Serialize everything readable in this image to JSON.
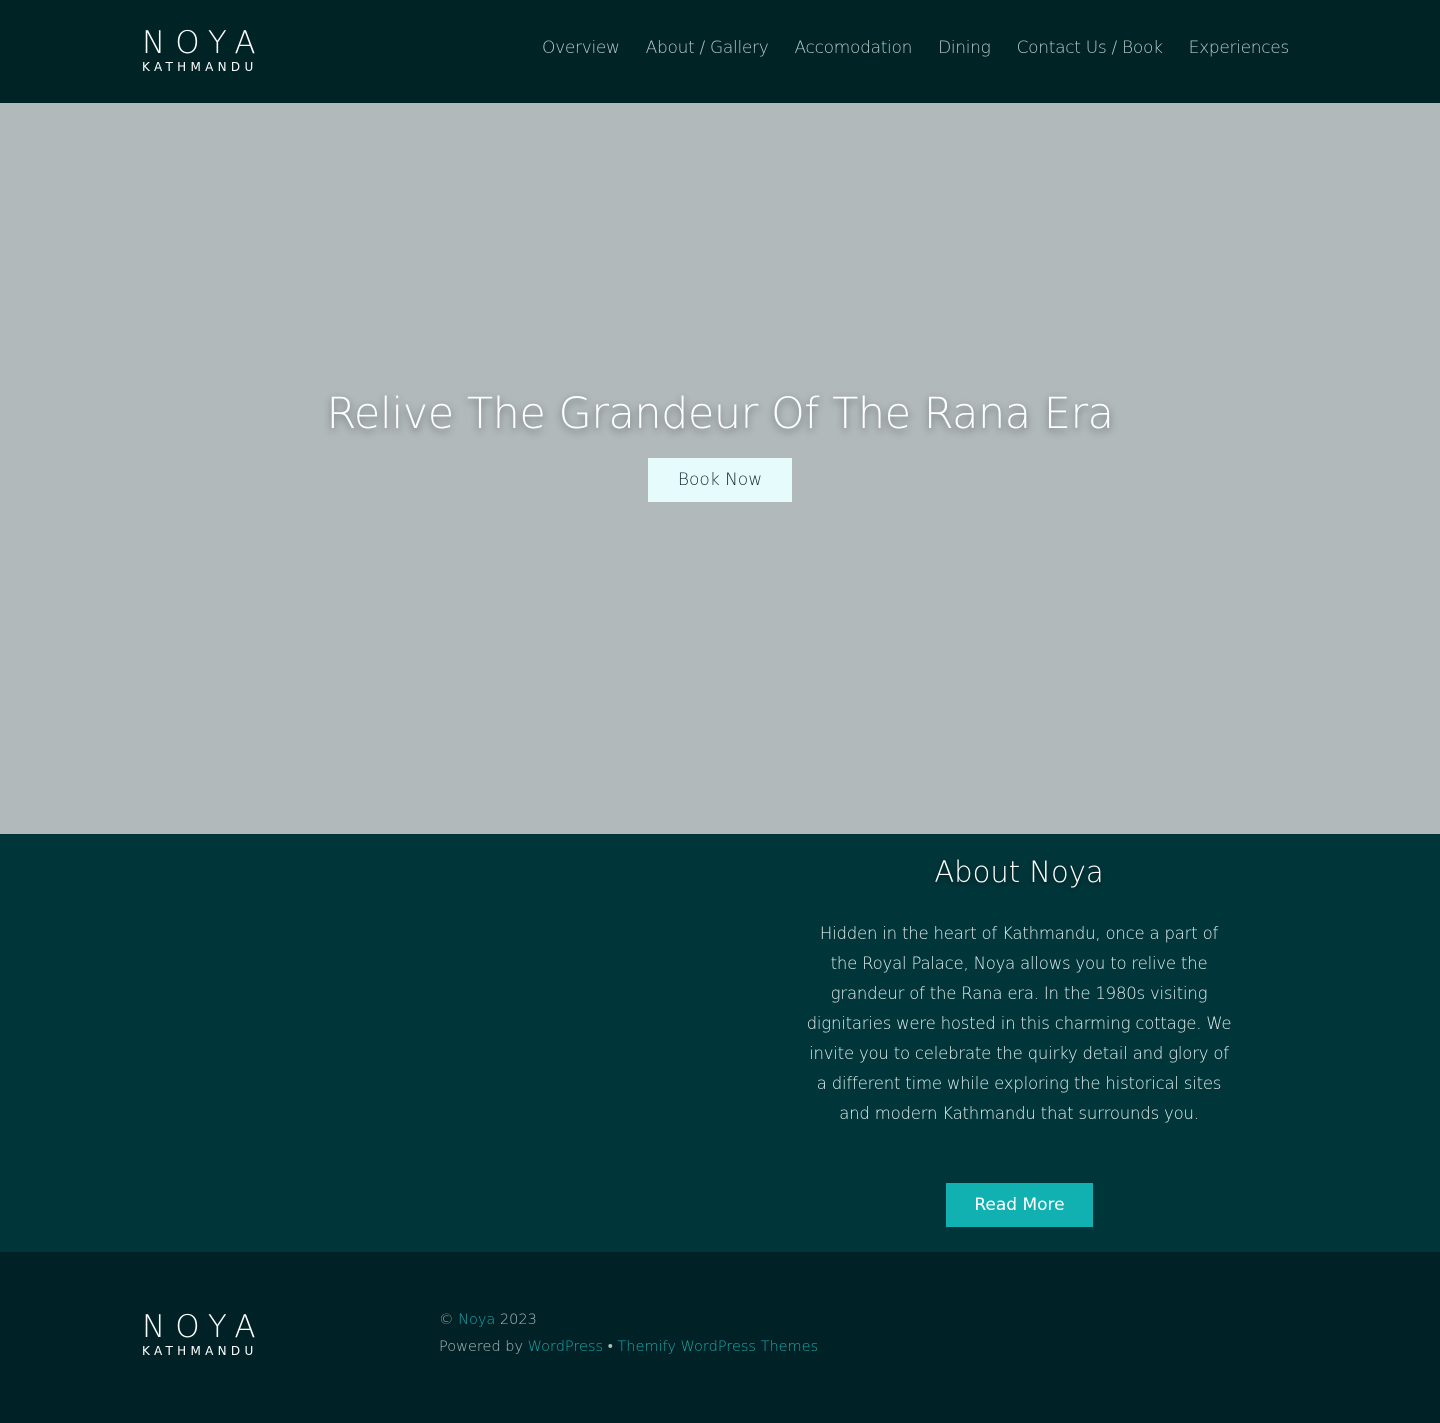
{
  "brand": {
    "name": "NOYA",
    "subtitle": "KATHMANDU"
  },
  "nav": {
    "items": [
      {
        "label": "Overview"
      },
      {
        "label": "About / Gallery"
      },
      {
        "label": "Accomodation"
      },
      {
        "label": "Dining"
      },
      {
        "label": "Contact Us / Book"
      },
      {
        "label": "Experiences"
      }
    ]
  },
  "hero": {
    "title": "Relive The Grandeur Of The Rana Era",
    "button_label": "Book Now"
  },
  "about": {
    "title": "About Noya",
    "text": "Hidden in the heart of Kathmandu, once a part of the Royal Palace, Noya allows you to relive the grandeur of the Rana era. In the 1980s visiting dignitaries were hosted in this charming cottage. We invite you to celebrate the quirky detail and glory of a different time while exploring the historical sites and modern Kathmandu that surrounds you.",
    "button_label": "Read More"
  },
  "footer": {
    "copyright_symbol": "©",
    "site_link": "Noya",
    "year": "2023",
    "powered_by": "Powered by",
    "wordpress_link": "WordPress",
    "separator": "•",
    "themify_link": "Themify WordPress Themes"
  },
  "colors": {
    "header_bg": "#002326",
    "hero_bg": "#b1b9ba",
    "about_bg": "#00363a",
    "accent": "#11b1b1",
    "hero_button_bg": "#e6fcfc",
    "footer_bg": "#002226"
  }
}
